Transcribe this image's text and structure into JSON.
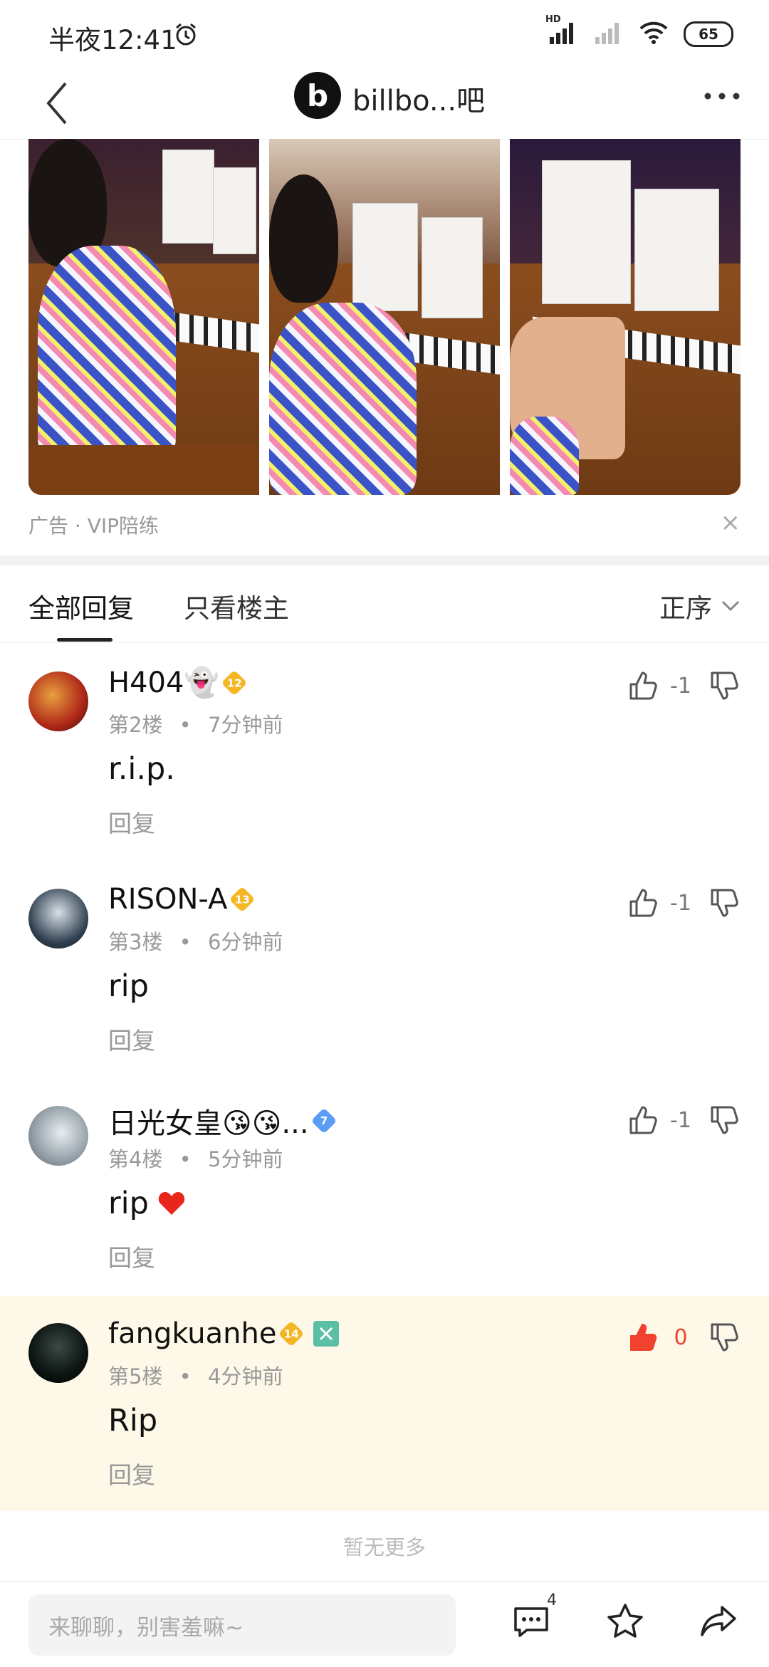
{
  "status_bar": {
    "time": "半夜12:41",
    "network_label": "HD",
    "battery": "65"
  },
  "nav": {
    "logo_letter": "b",
    "title": "billbo...吧"
  },
  "ad": {
    "caption": "广告 · VIP陪练",
    "close": "×"
  },
  "tabs": {
    "all": "全部回复",
    "owner_only": "只看楼主",
    "order": "正序"
  },
  "replies": [
    {
      "username": "H404👻",
      "level": "12",
      "floor": "第2楼",
      "time": "7分钟前",
      "content": "r.i.p.",
      "vote_count": "-1",
      "reply_label": "回复",
      "liked": false
    },
    {
      "username": "RISON-A",
      "level": "13",
      "floor": "第3楼",
      "time": "6分钟前",
      "content": "rip",
      "vote_count": "-1",
      "reply_label": "回复",
      "liked": false
    },
    {
      "username": "日光女皇😘😘...",
      "level": "7",
      "floor": "第4楼",
      "time": "5分钟前",
      "content": "rip",
      "vote_count": "-1",
      "reply_label": "回复",
      "liked": false,
      "content_emoji": "heart"
    },
    {
      "username": "fangkuanhe",
      "level": "14",
      "floor": "第5楼",
      "time": "4分钟前",
      "content": "Rip",
      "vote_count": "0",
      "reply_label": "回复",
      "liked": true
    }
  ],
  "meta_separator": "•",
  "footer_note": "暂无更多",
  "bottom": {
    "input_placeholder": "来聊聊，别害羞嘛~",
    "message_count": "4"
  },
  "colors": {
    "highlight_bg": "#fdf8e8",
    "like_red": "#f0422f",
    "badge_gold": "#f5b624",
    "badge_blue": "#5b9cf5",
    "badge_teal": "#5bbfa6"
  }
}
